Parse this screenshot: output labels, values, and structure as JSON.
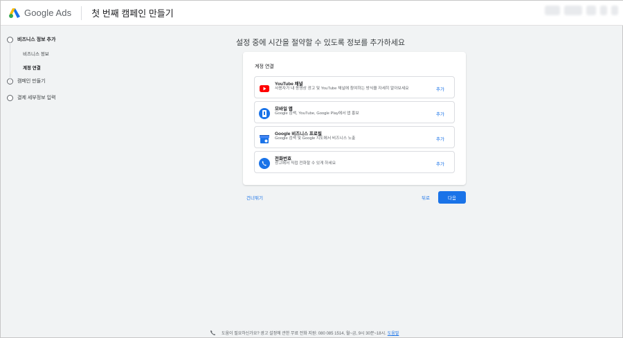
{
  "header": {
    "product_name": "Google Ads",
    "page_title": "첫 번째 캠페인 만들기"
  },
  "sidebar": {
    "steps": [
      {
        "label": "비즈니스 정보 추가",
        "substeps": [
          "비즈니스 정보",
          "계정 연결"
        ],
        "active_substep": "계정 연결"
      },
      {
        "label": "캠페인 만들기"
      },
      {
        "label": "결제 세부정보 입력"
      }
    ]
  },
  "main": {
    "heading": "설정 중에 시간을 절약할 수 있도록 정보를 추가하세요",
    "card_title": "계정 연결",
    "items": [
      {
        "icon": "youtube-icon",
        "title": "YouTube 채널",
        "desc": "사용자가 내 동영상 광고 및 YouTube 채널에 참여하는 방식을 자세히 알아보세요",
        "action": "추가"
      },
      {
        "icon": "mobile-app-icon",
        "title": "모바일 앱",
        "desc": "Google 검색, YouTube, Google Play에서 앱 홍보",
        "action": "추가"
      },
      {
        "icon": "business-profile-icon",
        "title": "Google 비즈니스 프로필",
        "desc": "Google 검색 및 Google 지도에서 비즈니스 노출",
        "action": "추가"
      },
      {
        "icon": "phone-icon",
        "title": "전화번호",
        "desc": "광고에서 직접 전화할 수 있게 하세요",
        "action": "추가"
      }
    ],
    "skip_label": "건너뛰기",
    "back_label": "뒤로",
    "next_label": "다음"
  },
  "footer": {
    "help_text": "도움이 필요하신가요? 광고 설정에 관한 무료 전화 지원: 080 085 1514, 월~금, 9시 30분~18시.",
    "help_link": "도움말"
  },
  "colors": {
    "accent": "#1a73e8",
    "youtube_red": "#ff0000",
    "background": "#f1f3f4"
  }
}
